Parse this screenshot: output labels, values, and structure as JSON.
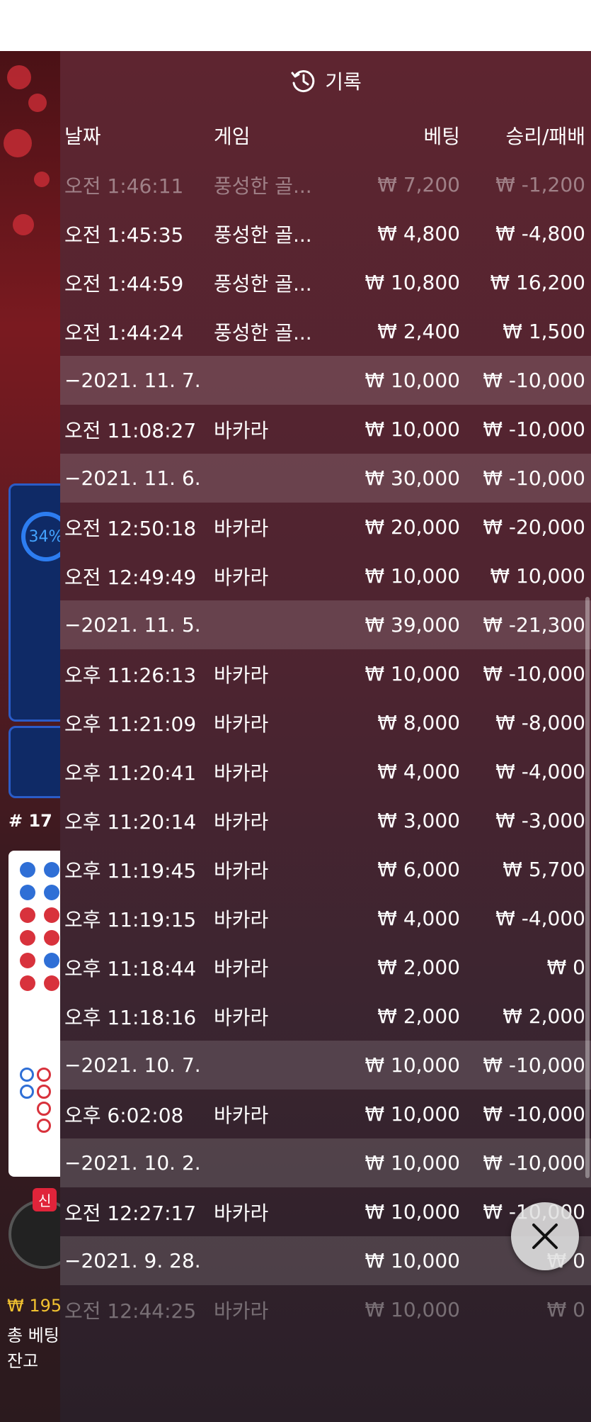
{
  "header": {
    "title": "기록"
  },
  "columns": {
    "date": "날짜",
    "game": "게임",
    "bet": "베팅",
    "result": "승리/패배"
  },
  "rows": [
    {
      "type": "entry",
      "date": "오전 1:46:11",
      "game": "풍성한 골...",
      "bet": "₩ 7,200",
      "result": "₩ -1,200",
      "faded": true
    },
    {
      "type": "entry",
      "date": "오전 1:45:35",
      "game": "풍성한 골...",
      "bet": "₩ 4,800",
      "result": "₩ -4,800"
    },
    {
      "type": "entry",
      "date": "오전 1:44:59",
      "game": "풍성한 골...",
      "bet": "₩ 10,800",
      "result": "₩ 16,200"
    },
    {
      "type": "entry",
      "date": "오전 1:44:24",
      "game": "풍성한 골...",
      "bet": "₩ 2,400",
      "result": "₩ 1,500"
    },
    {
      "type": "section",
      "date": "−2021. 11. 7.",
      "game": "",
      "bet": "₩ 10,000",
      "result": "₩ -10,000"
    },
    {
      "type": "entry",
      "date": "오전 11:08:27",
      "game": "바카라",
      "bet": "₩ 10,000",
      "result": "₩ -10,000"
    },
    {
      "type": "section",
      "date": "−2021. 11. 6.",
      "game": "",
      "bet": "₩ 30,000",
      "result": "₩ -10,000"
    },
    {
      "type": "entry",
      "date": "오전 12:50:18",
      "game": "바카라",
      "bet": "₩ 20,000",
      "result": "₩ -20,000"
    },
    {
      "type": "entry",
      "date": "오전 12:49:49",
      "game": "바카라",
      "bet": "₩ 10,000",
      "result": "₩ 10,000"
    },
    {
      "type": "section",
      "date": "−2021. 11. 5.",
      "game": "",
      "bet": "₩ 39,000",
      "result": "₩ -21,300"
    },
    {
      "type": "entry",
      "date": "오후 11:26:13",
      "game": "바카라",
      "bet": "₩ 10,000",
      "result": "₩ -10,000"
    },
    {
      "type": "entry",
      "date": "오후 11:21:09",
      "game": "바카라",
      "bet": "₩ 8,000",
      "result": "₩ -8,000"
    },
    {
      "type": "entry",
      "date": "오후 11:20:41",
      "game": "바카라",
      "bet": "₩ 4,000",
      "result": "₩ -4,000"
    },
    {
      "type": "entry",
      "date": "오후 11:20:14",
      "game": "바카라",
      "bet": "₩ 3,000",
      "result": "₩ -3,000"
    },
    {
      "type": "entry",
      "date": "오후 11:19:45",
      "game": "바카라",
      "bet": "₩ 6,000",
      "result": "₩ 5,700"
    },
    {
      "type": "entry",
      "date": "오후 11:19:15",
      "game": "바카라",
      "bet": "₩ 4,000",
      "result": "₩ -4,000"
    },
    {
      "type": "entry",
      "date": "오후 11:18:44",
      "game": "바카라",
      "bet": "₩ 2,000",
      "result": "₩ 0"
    },
    {
      "type": "entry",
      "date": "오후 11:18:16",
      "game": "바카라",
      "bet": "₩ 2,000",
      "result": "₩ 2,000"
    },
    {
      "type": "section",
      "date": "−2021. 10. 7.",
      "game": "",
      "bet": "₩ 10,000",
      "result": "₩ -10,000"
    },
    {
      "type": "entry",
      "date": "오후 6:02:08",
      "game": "바카라",
      "bet": "₩ 10,000",
      "result": "₩ -10,000"
    },
    {
      "type": "section",
      "date": "−2021. 10. 2.",
      "game": "",
      "bet": "₩ 10,000",
      "result": "₩ -10,000"
    },
    {
      "type": "entry",
      "date": "오전 12:27:17",
      "game": "바카라",
      "bet": "₩ 10,000",
      "result": "₩ -10,000"
    },
    {
      "type": "section",
      "date": "−2021. 9. 28.",
      "game": "",
      "bet": "₩ 10,000",
      "result": "₩ 0"
    },
    {
      "type": "entry",
      "date": "오전 12:44:25",
      "game": "바카라",
      "bet": "₩ 10,000",
      "result": "₩ 0",
      "faded": true
    }
  ],
  "background": {
    "progress_percent": "34%",
    "table_number": "# 17",
    "new_badge": "신",
    "balance_partial": "₩ 195",
    "total_bet_label": "총 베팅",
    "remaining_label": "잔고"
  },
  "icons": {
    "header": "history-clock-icon",
    "close": "close-icon"
  },
  "colors": {
    "drawer": "#5e2530",
    "section_row": "rgba(255,255,255,0.14)",
    "background_red": "#7a1a20"
  }
}
